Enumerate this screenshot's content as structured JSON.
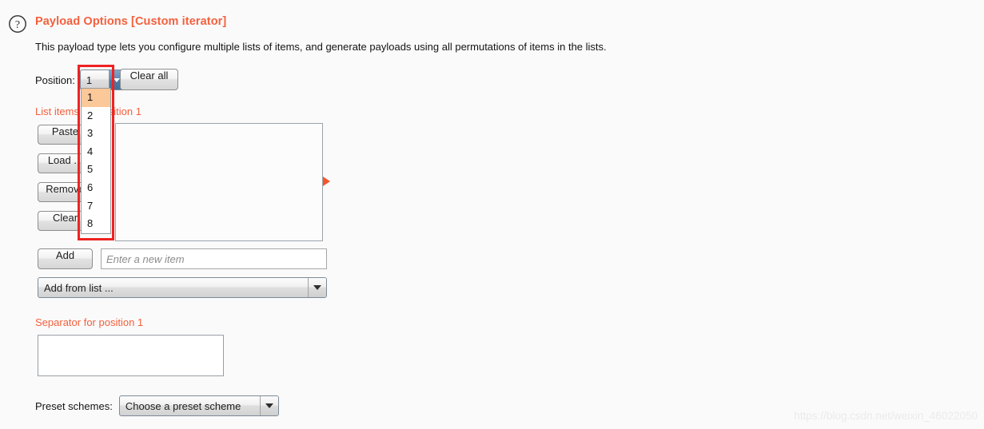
{
  "header": {
    "help_icon": "question-mark-circle-icon",
    "title": "Payload Options [Custom iterator]",
    "description": "This payload type lets you configure multiple lists of items, and generate payloads using all permutations of items in the lists."
  },
  "position": {
    "label": "Position:",
    "selected_value": "1",
    "options": [
      "1",
      "2",
      "3",
      "4",
      "5",
      "6",
      "7",
      "8"
    ],
    "dropdown_open": true,
    "highlighted_option": "1",
    "clear_all_label": "Clear all",
    "annotation_color": "#ee2222",
    "highlight_color": "#fbc89a"
  },
  "list_items": {
    "label": "List items for position 1",
    "buttons": [
      {
        "label": "Paste"
      },
      {
        "label": "Load ..."
      },
      {
        "label": "Remove"
      },
      {
        "label": "Clear"
      }
    ],
    "box_content": "",
    "marker_icon": "play-triangle-icon",
    "marker_color": "#f4562c"
  },
  "add_row": {
    "add_label": "Add",
    "input_value": "",
    "input_placeholder": "Enter a new item"
  },
  "add_from_list": {
    "selected_value": "Add from list ...",
    "arrow_icon": "chevron-down-icon"
  },
  "separator": {
    "label": "Separator for position 1",
    "value": ""
  },
  "preset": {
    "label": "Preset schemes:",
    "selected_value": "Choose a preset scheme",
    "arrow_icon": "chevron-down-icon"
  },
  "watermark": {
    "text": "https://blog.csdn.net/weixin_46022050"
  },
  "colors": {
    "accent": "#f4603e",
    "background": "#fafafa",
    "text": "#141414"
  }
}
